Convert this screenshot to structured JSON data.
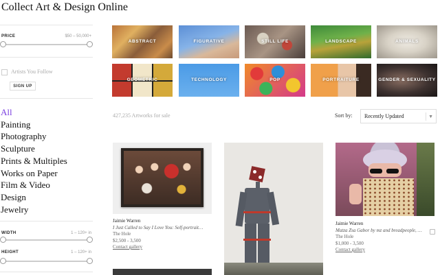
{
  "page": {
    "title": "Collect Art & Design Online"
  },
  "filters": {
    "price": {
      "label": "PRICE",
      "range": "$50 – 50,000+"
    },
    "follow": {
      "label": "Artists You Follow",
      "signup": "SIGN UP"
    },
    "width": {
      "label": "WIDTH",
      "range": "1 – 120+ in"
    },
    "height": {
      "label": "HEIGHT",
      "range": "1 – 120+ in"
    }
  },
  "mediums": [
    "All",
    "Painting",
    "Photography",
    "Sculpture",
    "Prints & Multiples",
    "Works on Paper",
    "Film & Video",
    "Design",
    "Jewelry"
  ],
  "categories": [
    "ABSTRACT",
    "FIGURATIVE",
    "STILL LIFE",
    "LANDSCAPE",
    "ANIMALS",
    "GEOMETRIC",
    "TECHNOLOGY",
    "POP",
    "PORTRAITURE",
    "GENDER & SEXUALITY"
  ],
  "results": {
    "count": "427,235 Artworks for sale",
    "sort_label": "Sort by:",
    "sort_value": "Recently Updated"
  },
  "artworks": [
    {
      "artist": "Jaimie Warren",
      "title": "I Just Called to Say I Love You: Self-portrait…",
      "gallery": "The Hole",
      "price": "$2,500 - 3,500",
      "contact": "Contact gallery"
    },
    {
      "artist": "Jaimie Warren",
      "title": "Matza Zsa Gabor by mz and breadpeople, …",
      "gallery": "The Hole",
      "price": "$1,000 - 3,500",
      "contact": "Contact gallery"
    }
  ],
  "colors": {
    "accent": "#7a3fe0"
  }
}
